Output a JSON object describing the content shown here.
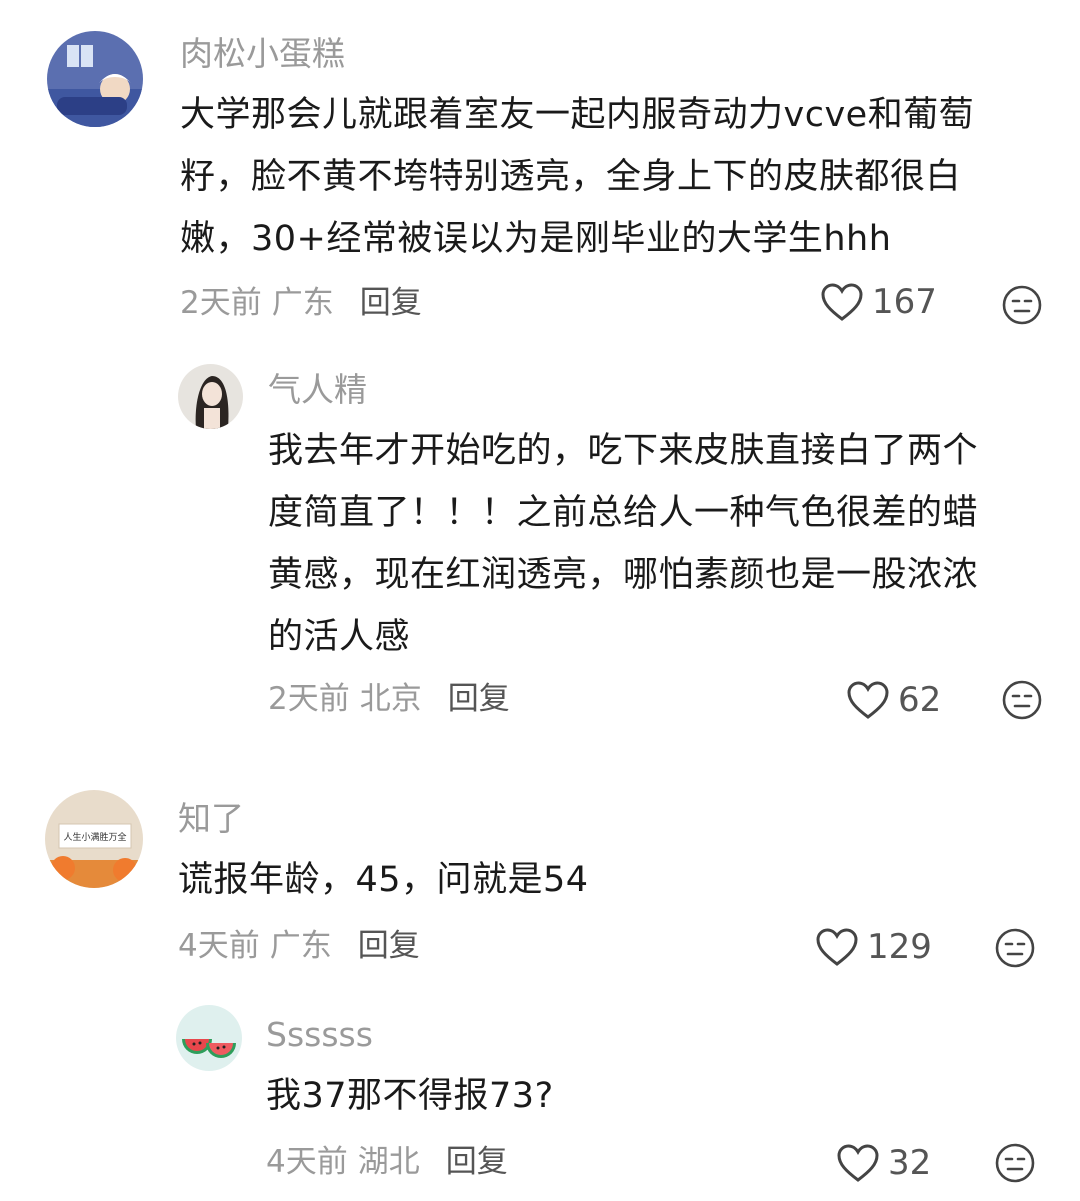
{
  "comments": [
    {
      "username": "肉松小蛋糕",
      "lines": [
        "大学那会儿就跟着室友一起内服奇动力vcve和葡萄",
        "籽，脸不黄不垮特别透亮，全身上下的皮肤都很白",
        "嫩，30+经常被误以为是刚毕业的大学生hhh"
      ],
      "time": "2天前",
      "location": "广东",
      "reply_label": "回复",
      "likes": "167",
      "replies": [
        {
          "username": "气人精",
          "lines": [
            "我去年才开始吃的，吃下来皮肤直接白了两个",
            "度简直了！！！之前总给人一种气色很差的蜡",
            "黄感，现在红润透亮，哪怕素颜也是一股浓浓",
            "的活人感"
          ],
          "time": "2天前",
          "location": "北京",
          "reply_label": "回复",
          "likes": "62"
        }
      ]
    },
    {
      "username": "知了",
      "lines": [
        "谎报年龄，45，问就是54"
      ],
      "time": "4天前",
      "location": "广东",
      "reply_label": "回复",
      "likes": "129",
      "avatar_note": "人生小满胜万全",
      "replies": [
        {
          "username": "Ssssss",
          "lines": [
            "我37那不得报73?"
          ],
          "time": "4天前",
          "location": "湖北",
          "reply_label": "回复",
          "likes": "32"
        }
      ]
    }
  ],
  "icons": {
    "like": "heart-outline-icon",
    "dislike": "meh-face-icon"
  },
  "colors": {
    "username": "#9a9a9a",
    "text": "#1a1a1a",
    "meta": "#9a9a9a",
    "reply": "#555555"
  }
}
